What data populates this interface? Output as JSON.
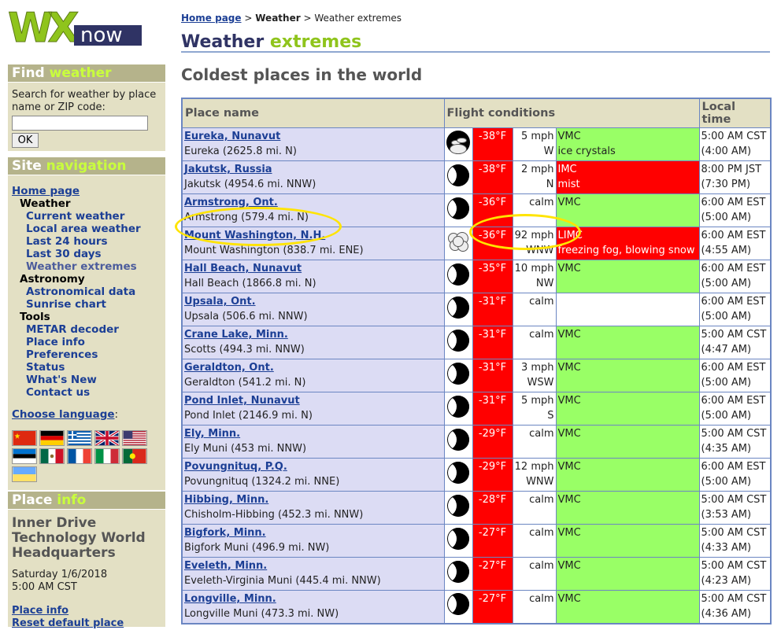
{
  "logo": {
    "wx": "WX",
    "now": "now"
  },
  "find": {
    "head_a": "Find",
    "head_b": "weather",
    "label": "Search for weather by place name or ZIP code:",
    "button": "OK"
  },
  "nav": {
    "head_a": "Site",
    "head_b": "navigation",
    "home": "Home page",
    "weather": "Weather",
    "weather_items": [
      "Current weather",
      "Local area weather",
      "Last 24 hours",
      "Last 30 days",
      "Weather extremes"
    ],
    "astronomy": "Astronomy",
    "astronomy_items": [
      "Astronomical data",
      "Sunrise chart"
    ],
    "tools": "Tools",
    "tools_items": [
      "METAR decoder",
      "Place info",
      "Preferences",
      "Status",
      "What's New",
      "Contact us"
    ],
    "choose_language": "Choose language",
    "colon": ":"
  },
  "place": {
    "head_a": "Place",
    "head_b": "info",
    "name": "Inner Drive Technology World Headquarters",
    "date": "Saturday 1/6/2018",
    "time": "5:00 AM CST",
    "link1": "Place info",
    "link2": "Reset default place"
  },
  "breadcrumb": {
    "home": "Home page",
    "sep1": ">",
    "weather": "Weather",
    "sep2": ">",
    "current": "Weather extremes"
  },
  "title": {
    "a": "Weather",
    "b": "extremes"
  },
  "subtitle": "Coldest places in the world",
  "table": {
    "headers": [
      "Place name",
      "Flight conditions",
      "Local time"
    ],
    "rows": [
      {
        "name": "Eureka, Nunavut",
        "station": "Eureka (2625.8 mi. N)",
        "icon": "cloudy-night-icon",
        "temp": "-38°F",
        "wind1": "5 mph",
        "wind2": "W",
        "cat": "VMC",
        "cond": "VMC",
        "cond2": "ice crystals",
        "t1": "5:00 AM CST",
        "t2": "(4:00 AM)"
      },
      {
        "name": "Jakutsk, Russia",
        "station": "Jakutsk (4954.6 mi. NNW)",
        "icon": "moon-icon",
        "temp": "-38°F",
        "wind1": "2 mph",
        "wind2": "N",
        "cat": "IMC",
        "cond": "IMC",
        "cond2": "mist",
        "t1": "8:00 PM JST",
        "t2": "(7:30 PM)"
      },
      {
        "name": "Armstrong, Ont.",
        "station": "Armstrong (579.4 mi. N)",
        "icon": "moon-icon",
        "temp": "-36°F",
        "wind1": "calm",
        "wind2": "",
        "cat": "VMC",
        "cond": "VMC",
        "cond2": "",
        "t1": "6:00 AM EST",
        "t2": "(5:00 AM)"
      },
      {
        "name": "Mount Washington, N.H.",
        "station": "Mount Washington (838.7 mi. ENE)",
        "icon": "fog-icon",
        "temp": "-36°F",
        "wind1": "92 mph",
        "wind2": "WNW",
        "cat": "LIMC",
        "cond": "LIMC",
        "cond2": "freezing fog, blowing snow",
        "t1": "6:00 AM EST",
        "t2": "(4:55 AM)"
      },
      {
        "name": "Hall Beach, Nunavut",
        "station": "Hall Beach (1866.8 mi. N)",
        "icon": "moon-icon",
        "temp": "-35°F",
        "wind1": "10 mph",
        "wind2": "NW",
        "cat": "VMC",
        "cond": "VMC",
        "cond2": "",
        "t1": "6:00 AM EST",
        "t2": "(5:00 AM)"
      },
      {
        "name": "Upsala, Ont.",
        "station": "Upsala (506.6 mi. NNW)",
        "icon": "moon-icon",
        "temp": "-31°F",
        "wind1": "calm",
        "wind2": "",
        "cat": "none",
        "cond": "",
        "cond2": "",
        "t1": "6:00 AM EST",
        "t2": "(5:00 AM)"
      },
      {
        "name": "Crane Lake, Minn.",
        "station": "Scotts (494.3 mi. NNW)",
        "icon": "moon-icon",
        "temp": "-31°F",
        "wind1": "calm",
        "wind2": "",
        "cat": "VMC",
        "cond": "VMC",
        "cond2": "",
        "t1": "5:00 AM CST",
        "t2": "(4:47 AM)"
      },
      {
        "name": "Geraldton, Ont.",
        "station": "Geraldton (541.2 mi. N)",
        "icon": "moon-icon",
        "temp": "-31°F",
        "wind1": "3 mph",
        "wind2": "WSW",
        "cat": "VMC",
        "cond": "VMC",
        "cond2": "",
        "t1": "6:00 AM EST",
        "t2": "(5:00 AM)"
      },
      {
        "name": "Pond Inlet, Nunavut",
        "station": "Pond Inlet (2146.9 mi. N)",
        "icon": "moon-icon",
        "temp": "-31°F",
        "wind1": "5 mph",
        "wind2": "S",
        "cat": "VMC",
        "cond": "VMC",
        "cond2": "",
        "t1": "6:00 AM EST",
        "t2": "(5:00 AM)"
      },
      {
        "name": "Ely, Minn.",
        "station": "Ely Muni (453 mi. NNW)",
        "icon": "moon-icon",
        "temp": "-29°F",
        "wind1": "calm",
        "wind2": "",
        "cat": "VMC",
        "cond": "VMC",
        "cond2": "",
        "t1": "5:00 AM CST",
        "t2": "(4:35 AM)"
      },
      {
        "name": "Povungnituq, P.Q.",
        "station": "Povungnituq (1324.2 mi. NNE)",
        "icon": "moon-icon",
        "temp": "-29°F",
        "wind1": "12 mph",
        "wind2": "WNW",
        "cat": "VMC",
        "cond": "VMC",
        "cond2": "",
        "t1": "6:00 AM EST",
        "t2": "(5:00 AM)"
      },
      {
        "name": "Hibbing, Minn.",
        "station": "Chisholm-Hibbing (452.3 mi. NNW)",
        "icon": "moon-icon",
        "temp": "-28°F",
        "wind1": "calm",
        "wind2": "",
        "cat": "VMC",
        "cond": "VMC",
        "cond2": "",
        "t1": "5:00 AM CST",
        "t2": "(3:53 AM)"
      },
      {
        "name": "Bigfork, Minn.",
        "station": "Bigfork Muni (496.9 mi. NW)",
        "icon": "moon-icon",
        "temp": "-27°F",
        "wind1": "calm",
        "wind2": "",
        "cat": "VMC",
        "cond": "VMC",
        "cond2": "",
        "t1": "5:00 AM CST",
        "t2": "(4:33 AM)"
      },
      {
        "name": "Eveleth, Minn.",
        "station": "Eveleth-Virginia Muni (445.4 mi. NNW)",
        "icon": "moon-icon",
        "temp": "-27°F",
        "wind1": "calm",
        "wind2": "",
        "cat": "VMC",
        "cond": "VMC",
        "cond2": "",
        "t1": "5:00 AM CST",
        "t2": "(4:23 AM)"
      },
      {
        "name": "Longville, Minn.",
        "station": "Longville Muni (473.3 mi. NW)",
        "icon": "moon-icon",
        "temp": "-27°F",
        "wind1": "calm",
        "wind2": "",
        "cat": "VMC",
        "cond": "VMC",
        "cond2": "",
        "t1": "5:00 AM CST",
        "t2": "(4:36 AM)"
      }
    ]
  },
  "colors": {
    "accent": "#8fc41c",
    "navy": "#2f3364",
    "sidebar": "#e3e0c4",
    "sidebar_head": "#b5b38b",
    "vmc": "#99ff66",
    "imc": "#ff0000",
    "place_bg": "#dcdcf4",
    "highlight": "#ffe400"
  }
}
